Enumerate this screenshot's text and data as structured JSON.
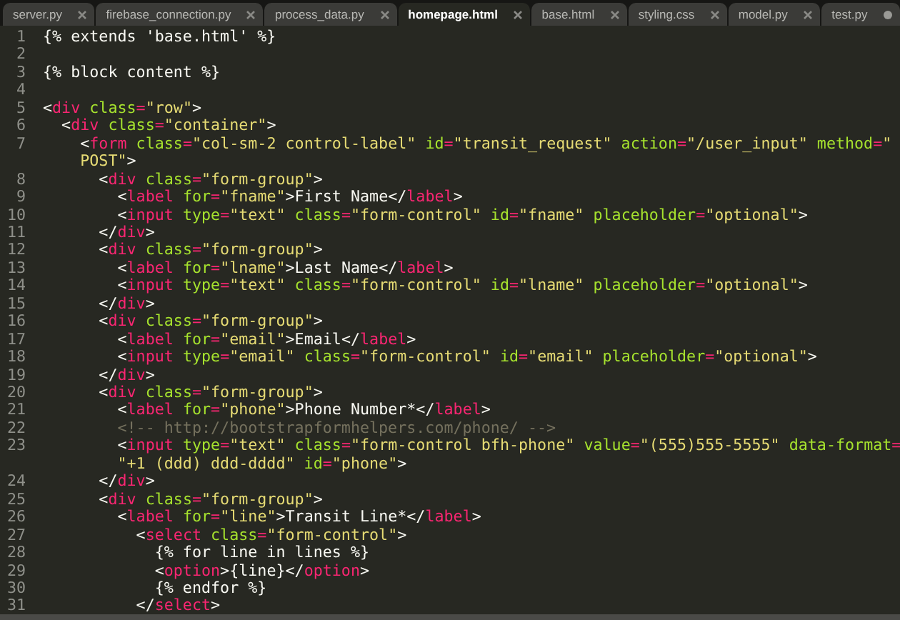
{
  "tabs": [
    {
      "label": "server.py",
      "selected": false,
      "modified": false
    },
    {
      "label": "firebase_connection.py",
      "selected": false,
      "modified": false
    },
    {
      "label": "process_data.py",
      "selected": false,
      "modified": false
    },
    {
      "label": "homepage.html",
      "selected": true,
      "modified": false
    },
    {
      "label": "base.html",
      "selected": false,
      "modified": false
    },
    {
      "label": "styling.css",
      "selected": false,
      "modified": false
    },
    {
      "label": "model.py",
      "selected": false,
      "modified": false
    },
    {
      "label": "test.py",
      "selected": false,
      "modified": true
    }
  ],
  "lines": [
    {
      "number": "1",
      "rows": [
        {
          "tokens": [
            {
              "kind": "text",
              "text": "{% extends 'base.html' %}"
            }
          ]
        }
      ]
    },
    {
      "number": "2",
      "rows": [
        {}
      ]
    },
    {
      "number": "3",
      "rows": [
        {
          "tokens": [
            {
              "kind": "text",
              "text": "{% block content %}"
            }
          ]
        }
      ]
    },
    {
      "number": "4",
      "rows": [
        {}
      ]
    },
    {
      "number": "5",
      "rows": [
        {
          "tokens": [
            {
              "kind": "text",
              "text": "<"
            },
            {
              "kind": "tag",
              "text": "div"
            },
            {
              "kind": "attr",
              "text": " class"
            },
            {
              "kind": "op",
              "text": "="
            },
            {
              "kind": "string",
              "text": "\"row\""
            },
            {
              "kind": "text",
              "text": ">"
            }
          ]
        }
      ]
    },
    {
      "number": "6",
      "rows": [
        {
          "tokens": [
            {
              "kind": "text",
              "text": "  <"
            },
            {
              "kind": "tag",
              "text": "div"
            },
            {
              "kind": "attr",
              "text": " class"
            },
            {
              "kind": "op",
              "text": "="
            },
            {
              "kind": "string",
              "text": "\"container\""
            },
            {
              "kind": "text",
              "text": ">"
            }
          ]
        }
      ]
    },
    {
      "number": "7",
      "rows": [
        {
          "tokens": [
            {
              "kind": "text",
              "text": "    <"
            },
            {
              "kind": "tag",
              "text": "form"
            },
            {
              "kind": "attr",
              "text": " class"
            },
            {
              "kind": "op",
              "text": "="
            },
            {
              "kind": "string",
              "text": "\"col-sm-2 control-label\""
            },
            {
              "kind": "attr",
              "text": " id"
            },
            {
              "kind": "op",
              "text": "="
            },
            {
              "kind": "string",
              "text": "\"transit_request\""
            },
            {
              "kind": "attr",
              "text": " action"
            },
            {
              "kind": "op",
              "text": "="
            },
            {
              "kind": "string",
              "text": "\"/user_input\""
            },
            {
              "kind": "attr",
              "text": " method"
            },
            {
              "kind": "op",
              "text": "="
            },
            {
              "kind": "string",
              "text": "\""
            }
          ]
        },
        {
          "tokens": [
            {
              "kind": "string",
              "text": "    POST\""
            },
            {
              "kind": "text",
              "text": ">"
            }
          ]
        }
      ]
    },
    {
      "number": "8",
      "rows": [
        {
          "tokens": [
            {
              "kind": "text",
              "text": "      <"
            },
            {
              "kind": "tag",
              "text": "div"
            },
            {
              "kind": "attr",
              "text": " class"
            },
            {
              "kind": "op",
              "text": "="
            },
            {
              "kind": "string",
              "text": "\"form-group\""
            },
            {
              "kind": "text",
              "text": ">"
            }
          ]
        }
      ]
    },
    {
      "number": "9",
      "rows": [
        {
          "tokens": [
            {
              "kind": "text",
              "text": "        <"
            },
            {
              "kind": "tag",
              "text": "label"
            },
            {
              "kind": "attr",
              "text": " for"
            },
            {
              "kind": "op",
              "text": "="
            },
            {
              "kind": "string",
              "text": "\"fname\""
            },
            {
              "kind": "text",
              "text": ">First Name</"
            },
            {
              "kind": "tag",
              "text": "label"
            },
            {
              "kind": "text",
              "text": ">"
            }
          ]
        }
      ]
    },
    {
      "number": "10",
      "rows": [
        {
          "tokens": [
            {
              "kind": "text",
              "text": "        <"
            },
            {
              "kind": "tag",
              "text": "input"
            },
            {
              "kind": "attr",
              "text": " type"
            },
            {
              "kind": "op",
              "text": "="
            },
            {
              "kind": "string",
              "text": "\"text\""
            },
            {
              "kind": "attr",
              "text": " class"
            },
            {
              "kind": "op",
              "text": "="
            },
            {
              "kind": "string",
              "text": "\"form-control\""
            },
            {
              "kind": "attr",
              "text": " id"
            },
            {
              "kind": "op",
              "text": "="
            },
            {
              "kind": "string",
              "text": "\"fname\""
            },
            {
              "kind": "attr",
              "text": " placeholder"
            },
            {
              "kind": "op",
              "text": "="
            },
            {
              "kind": "string",
              "text": "\"optional\""
            },
            {
              "kind": "text",
              "text": ">"
            }
          ]
        }
      ]
    },
    {
      "number": "11",
      "rows": [
        {
          "tokens": [
            {
              "kind": "text",
              "text": "      </"
            },
            {
              "kind": "tag",
              "text": "div"
            },
            {
              "kind": "text",
              "text": ">"
            }
          ]
        }
      ]
    },
    {
      "number": "12",
      "rows": [
        {
          "tokens": [
            {
              "kind": "text",
              "text": "      <"
            },
            {
              "kind": "tag",
              "text": "div"
            },
            {
              "kind": "attr",
              "text": " class"
            },
            {
              "kind": "op",
              "text": "="
            },
            {
              "kind": "string",
              "text": "\"form-group\""
            },
            {
              "kind": "text",
              "text": ">"
            }
          ]
        }
      ]
    },
    {
      "number": "13",
      "rows": [
        {
          "tokens": [
            {
              "kind": "text",
              "text": "        <"
            },
            {
              "kind": "tag",
              "text": "label"
            },
            {
              "kind": "attr",
              "text": " for"
            },
            {
              "kind": "op",
              "text": "="
            },
            {
              "kind": "string",
              "text": "\"lname\""
            },
            {
              "kind": "text",
              "text": ">Last Name</"
            },
            {
              "kind": "tag",
              "text": "label"
            },
            {
              "kind": "text",
              "text": ">"
            }
          ]
        }
      ]
    },
    {
      "number": "14",
      "rows": [
        {
          "tokens": [
            {
              "kind": "text",
              "text": "        <"
            },
            {
              "kind": "tag",
              "text": "input"
            },
            {
              "kind": "attr",
              "text": " type"
            },
            {
              "kind": "op",
              "text": "="
            },
            {
              "kind": "string",
              "text": "\"text\""
            },
            {
              "kind": "attr",
              "text": " class"
            },
            {
              "kind": "op",
              "text": "="
            },
            {
              "kind": "string",
              "text": "\"form-control\""
            },
            {
              "kind": "attr",
              "text": " id"
            },
            {
              "kind": "op",
              "text": "="
            },
            {
              "kind": "string",
              "text": "\"lname\""
            },
            {
              "kind": "attr",
              "text": " placeholder"
            },
            {
              "kind": "op",
              "text": "="
            },
            {
              "kind": "string",
              "text": "\"optional\""
            },
            {
              "kind": "text",
              "text": ">"
            }
          ]
        }
      ]
    },
    {
      "number": "15",
      "rows": [
        {
          "tokens": [
            {
              "kind": "text",
              "text": "      </"
            },
            {
              "kind": "tag",
              "text": "div"
            },
            {
              "kind": "text",
              "text": ">"
            }
          ]
        }
      ]
    },
    {
      "number": "16",
      "rows": [
        {
          "tokens": [
            {
              "kind": "text",
              "text": "      <"
            },
            {
              "kind": "tag",
              "text": "div"
            },
            {
              "kind": "attr",
              "text": " class"
            },
            {
              "kind": "op",
              "text": "="
            },
            {
              "kind": "string",
              "text": "\"form-group\""
            },
            {
              "kind": "text",
              "text": ">"
            }
          ]
        }
      ]
    },
    {
      "number": "17",
      "rows": [
        {
          "tokens": [
            {
              "kind": "text",
              "text": "        <"
            },
            {
              "kind": "tag",
              "text": "label"
            },
            {
              "kind": "attr",
              "text": " for"
            },
            {
              "kind": "op",
              "text": "="
            },
            {
              "kind": "string",
              "text": "\"email\""
            },
            {
              "kind": "text",
              "text": ">Email</"
            },
            {
              "kind": "tag",
              "text": "label"
            },
            {
              "kind": "text",
              "text": ">"
            }
          ]
        }
      ]
    },
    {
      "number": "18",
      "rows": [
        {
          "tokens": [
            {
              "kind": "text",
              "text": "        <"
            },
            {
              "kind": "tag",
              "text": "input"
            },
            {
              "kind": "attr",
              "text": " type"
            },
            {
              "kind": "op",
              "text": "="
            },
            {
              "kind": "string",
              "text": "\"email\""
            },
            {
              "kind": "attr",
              "text": " class"
            },
            {
              "kind": "op",
              "text": "="
            },
            {
              "kind": "string",
              "text": "\"form-control\""
            },
            {
              "kind": "attr",
              "text": " id"
            },
            {
              "kind": "op",
              "text": "="
            },
            {
              "kind": "string",
              "text": "\"email\""
            },
            {
              "kind": "attr",
              "text": " placeholder"
            },
            {
              "kind": "op",
              "text": "="
            },
            {
              "kind": "string",
              "text": "\"optional\""
            },
            {
              "kind": "text",
              "text": ">"
            }
          ]
        }
      ]
    },
    {
      "number": "19",
      "rows": [
        {
          "tokens": [
            {
              "kind": "text",
              "text": "      </"
            },
            {
              "kind": "tag",
              "text": "div"
            },
            {
              "kind": "text",
              "text": ">"
            }
          ]
        }
      ]
    },
    {
      "number": "20",
      "rows": [
        {
          "tokens": [
            {
              "kind": "text",
              "text": "      <"
            },
            {
              "kind": "tag",
              "text": "div"
            },
            {
              "kind": "attr",
              "text": " class"
            },
            {
              "kind": "op",
              "text": "="
            },
            {
              "kind": "string",
              "text": "\"form-group\""
            },
            {
              "kind": "text",
              "text": ">"
            }
          ]
        }
      ]
    },
    {
      "number": "21",
      "rows": [
        {
          "tokens": [
            {
              "kind": "text",
              "text": "        <"
            },
            {
              "kind": "tag",
              "text": "label"
            },
            {
              "kind": "attr",
              "text": " for"
            },
            {
              "kind": "op",
              "text": "="
            },
            {
              "kind": "string",
              "text": "\"phone\""
            },
            {
              "kind": "text",
              "text": ">Phone Number*</"
            },
            {
              "kind": "tag",
              "text": "label"
            },
            {
              "kind": "text",
              "text": ">"
            }
          ]
        }
      ]
    },
    {
      "number": "22",
      "rows": [
        {
          "tokens": [
            {
              "kind": "comment",
              "text": "        <!-- http://bootstrapformhelpers.com/phone/ -->"
            }
          ]
        }
      ]
    },
    {
      "number": "23",
      "rows": [
        {
          "tokens": [
            {
              "kind": "text",
              "text": "        <"
            },
            {
              "kind": "tag",
              "text": "input"
            },
            {
              "kind": "attr",
              "text": " type"
            },
            {
              "kind": "op",
              "text": "="
            },
            {
              "kind": "string",
              "text": "\"text\""
            },
            {
              "kind": "attr",
              "text": " class"
            },
            {
              "kind": "op",
              "text": "="
            },
            {
              "kind": "string",
              "text": "\"form-control bfh-phone\""
            },
            {
              "kind": "attr",
              "text": " value"
            },
            {
              "kind": "op",
              "text": "="
            },
            {
              "kind": "string",
              "text": "\"(555)555-5555\""
            },
            {
              "kind": "attr",
              "text": " data-format"
            },
            {
              "kind": "op",
              "text": "="
            }
          ]
        },
        {
          "tokens": [
            {
              "kind": "string",
              "text": "        \"+1 (ddd) ddd-dddd\""
            },
            {
              "kind": "attr",
              "text": " id"
            },
            {
              "kind": "op",
              "text": "="
            },
            {
              "kind": "string",
              "text": "\"phone\""
            },
            {
              "kind": "text",
              "text": ">"
            }
          ]
        }
      ]
    },
    {
      "number": "24",
      "rows": [
        {
          "tokens": [
            {
              "kind": "text",
              "text": "      </"
            },
            {
              "kind": "tag",
              "text": "div"
            },
            {
              "kind": "text",
              "text": ">"
            }
          ]
        }
      ]
    },
    {
      "number": "25",
      "rows": [
        {
          "tokens": [
            {
              "kind": "text",
              "text": "      <"
            },
            {
              "kind": "tag",
              "text": "div"
            },
            {
              "kind": "attr",
              "text": " class"
            },
            {
              "kind": "op",
              "text": "="
            },
            {
              "kind": "string",
              "text": "\"form-group\""
            },
            {
              "kind": "text",
              "text": ">"
            }
          ]
        }
      ]
    },
    {
      "number": "26",
      "rows": [
        {
          "tokens": [
            {
              "kind": "text",
              "text": "        <"
            },
            {
              "kind": "tag",
              "text": "label"
            },
            {
              "kind": "attr",
              "text": " for"
            },
            {
              "kind": "op",
              "text": "="
            },
            {
              "kind": "string",
              "text": "\"line\""
            },
            {
              "kind": "text",
              "text": ">Transit Line*</"
            },
            {
              "kind": "tag",
              "text": "label"
            },
            {
              "kind": "text",
              "text": ">"
            }
          ]
        }
      ]
    },
    {
      "number": "27",
      "rows": [
        {
          "tokens": [
            {
              "kind": "text",
              "text": "          <"
            },
            {
              "kind": "tag",
              "text": "select"
            },
            {
              "kind": "attr",
              "text": " class"
            },
            {
              "kind": "op",
              "text": "="
            },
            {
              "kind": "string",
              "text": "\"form-control\""
            },
            {
              "kind": "text",
              "text": ">"
            }
          ]
        }
      ]
    },
    {
      "number": "28",
      "rows": [
        {
          "tokens": [
            {
              "kind": "text",
              "text": "            {% for line in lines %}"
            }
          ]
        }
      ]
    },
    {
      "number": "29",
      "rows": [
        {
          "tokens": [
            {
              "kind": "text",
              "text": "            <"
            },
            {
              "kind": "tag",
              "text": "option"
            },
            {
              "kind": "text",
              "text": ">{line}</"
            },
            {
              "kind": "tag",
              "text": "option"
            },
            {
              "kind": "text",
              "text": ">"
            }
          ]
        }
      ]
    },
    {
      "number": "30",
      "rows": [
        {
          "tokens": [
            {
              "kind": "text",
              "text": "            {% endfor %}"
            }
          ]
        }
      ]
    },
    {
      "number": "31",
      "rows": [
        {
          "tokens": [
            {
              "kind": "text",
              "text": "          </"
            },
            {
              "kind": "tag",
              "text": "select"
            },
            {
              "kind": "text",
              "text": ">"
            }
          ]
        }
      ]
    }
  ]
}
